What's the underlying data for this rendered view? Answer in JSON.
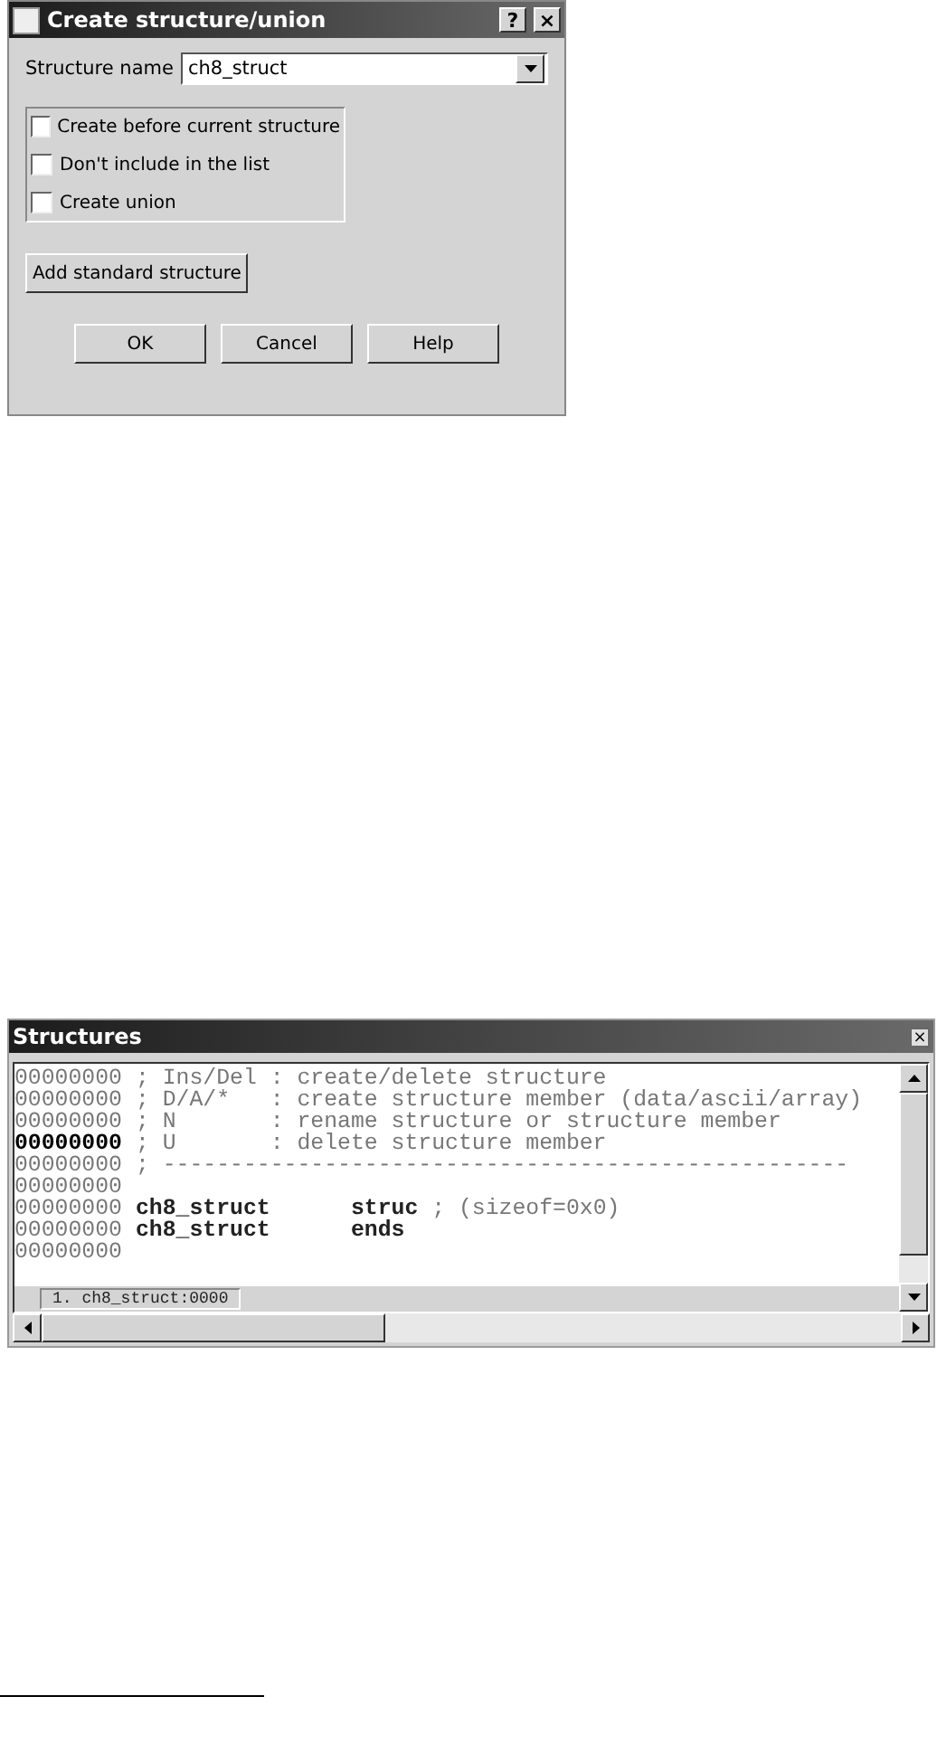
{
  "dialog": {
    "title": "Create structure/union",
    "help_button": "?",
    "close_button": "×",
    "structure_name": {
      "label": "Structure name",
      "value": "ch8_struct"
    },
    "options": [
      {
        "label": "Create before current structure",
        "checked": false
      },
      {
        "label": "Don't include in the list",
        "checked": false
      },
      {
        "label": "Create union",
        "checked": false
      }
    ],
    "add_button": "Add standard structure",
    "buttons": [
      "OK",
      "Cancel",
      "Help"
    ]
  },
  "structures_window": {
    "title": "Structures",
    "close_button": "×",
    "lines": [
      {
        "address": "00000000",
        "current": false,
        "parts": [
          {
            "kind": "comment",
            "text": "; Ins/Del : create/delete structure"
          }
        ]
      },
      {
        "address": "00000000",
        "current": false,
        "parts": [
          {
            "kind": "comment",
            "text": "; D/A/*   : create structure member (data/ascii/array)"
          }
        ]
      },
      {
        "address": "00000000",
        "current": false,
        "parts": [
          {
            "kind": "comment",
            "text": "; N       : rename structure or structure member"
          }
        ]
      },
      {
        "address": "00000000",
        "current": true,
        "parts": [
          {
            "kind": "comment",
            "text": "; U       : delete structure member"
          }
        ]
      },
      {
        "address": "00000000",
        "current": false,
        "parts": [
          {
            "kind": "comment",
            "text": "; ---------------------------------------------------"
          }
        ]
      },
      {
        "address": "00000000",
        "current": false
      },
      {
        "address": "00000000",
        "current": false,
        "parts": [
          {
            "kind": "code",
            "text": "ch8_struct      struc"
          },
          {
            "kind": "comment",
            "text": " ; (sizeof=0x0)"
          }
        ]
      },
      {
        "address": "00000000",
        "current": false,
        "parts": [
          {
            "kind": "code",
            "text": "ch8_struct      ends"
          }
        ]
      },
      {
        "address": "00000000",
        "current": false
      }
    ],
    "status_tab": "1. ch8_struct:0000"
  }
}
